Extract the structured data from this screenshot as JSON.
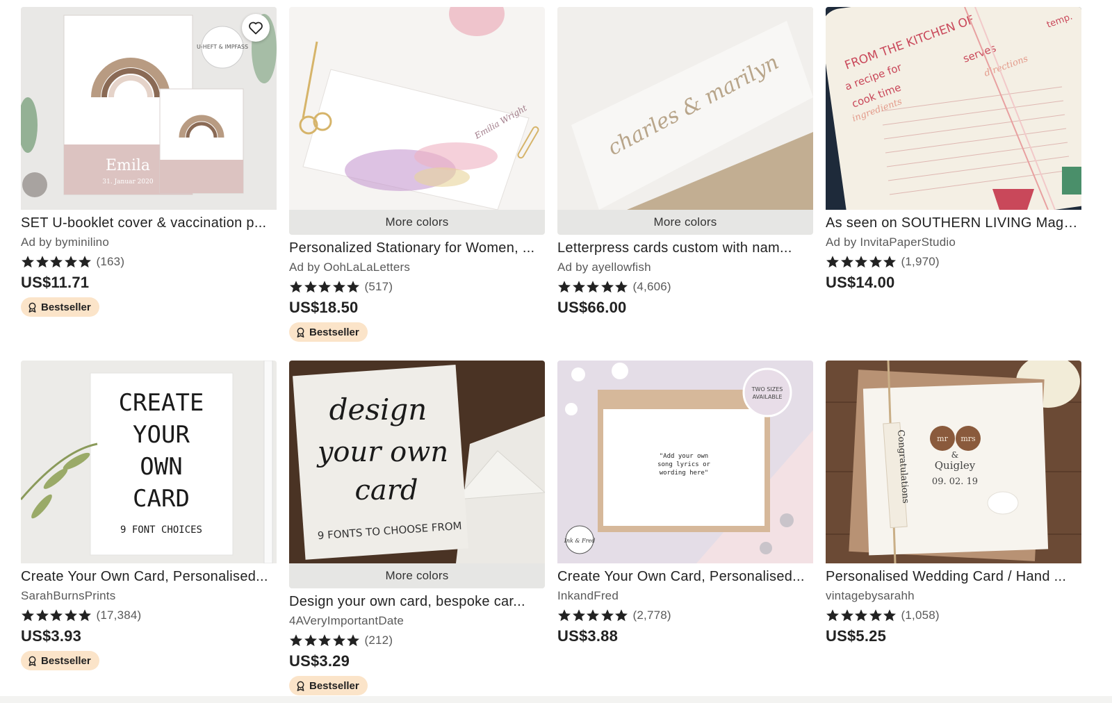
{
  "colors": {
    "star": "#222222",
    "badge_bg": "#fbe4c9",
    "more_colors_bg": "#e6e6e4"
  },
  "icons": {
    "favorite": "heart-outline-icon",
    "bestseller": "award-ribbon-icon",
    "star": "star-icon"
  },
  "listings": [
    {
      "title": "SET U-booklet cover & vaccination p...",
      "shop": "Ad by byminilino",
      "rating": 5,
      "reviews": "(163)",
      "price": "US$11.71",
      "badge": "Bestseller",
      "more_colors": "",
      "image_text": [
        "Emila",
        "31. Januar 2020",
        "U-HEFT & IMPFASS"
      ]
    },
    {
      "title": "Personalized Stationary for Women, ...",
      "shop": "Ad by OohLaLaLetters",
      "rating": 5,
      "reviews": "(517)",
      "price": "US$18.50",
      "badge": "Bestseller",
      "more_colors": "More colors",
      "image_text": [
        "Emilia Wright"
      ]
    },
    {
      "title": "Letterpress cards custom with nam...",
      "shop": "Ad by ayellowfish",
      "rating": 5,
      "reviews": "(4,606)",
      "price": "US$66.00",
      "badge": "",
      "more_colors": "More colors",
      "image_text": [
        "charles & marilyn"
      ]
    },
    {
      "title": "As seen on SOUTHERN LIVING Maga...",
      "shop": "Ad by InvitaPaperStudio",
      "rating": 5,
      "reviews": "(1,970)",
      "price": "US$14.00",
      "badge": "",
      "more_colors": "",
      "image_text": [
        "FROM THE KITCHEN OF",
        "a recipe for",
        "cook time",
        "serves",
        "temp.",
        "ingredients",
        "directions"
      ]
    },
    {
      "title": "Create Your Own Card, Personalised...",
      "shop": "SarahBurnsPrints",
      "rating": 5,
      "reviews": "(17,384)",
      "price": "US$3.93",
      "badge": "Bestseller",
      "more_colors": "",
      "image_text": [
        "CREATE",
        "YOUR",
        "OWN",
        "CARD",
        "9 FONT CHOICES"
      ]
    },
    {
      "title": "Design your own card, bespoke car...",
      "shop": "4AVeryImportantDate",
      "rating": 5,
      "reviews": "(212)",
      "price": "US$3.29",
      "badge": "Bestseller",
      "more_colors": "More colors",
      "image_text": [
        "design",
        "your own",
        "card",
        "9 FONTS TO CHOOSE FROM"
      ]
    },
    {
      "title": "Create Your Own Card, Personalised...",
      "shop": "InkandFred",
      "rating": 5,
      "reviews": "(2,778)",
      "price": "US$3.88",
      "badge": "",
      "more_colors": "",
      "image_text": [
        "\"Add your own",
        "song lyrics or",
        "wording here\"",
        "TWO SIZES",
        "AVAILABLE",
        "Ink & Fred"
      ]
    },
    {
      "title": "Personalised Wedding Card / Hand ...",
      "shop": "vintagebysarahh",
      "rating": 5,
      "reviews": "(1,058)",
      "price": "US$5.25",
      "badge": "",
      "more_colors": "",
      "image_text": [
        "Congratulations",
        "mr",
        "mrs",
        "&",
        "Quigley",
        "09. 02. 19"
      ]
    }
  ]
}
